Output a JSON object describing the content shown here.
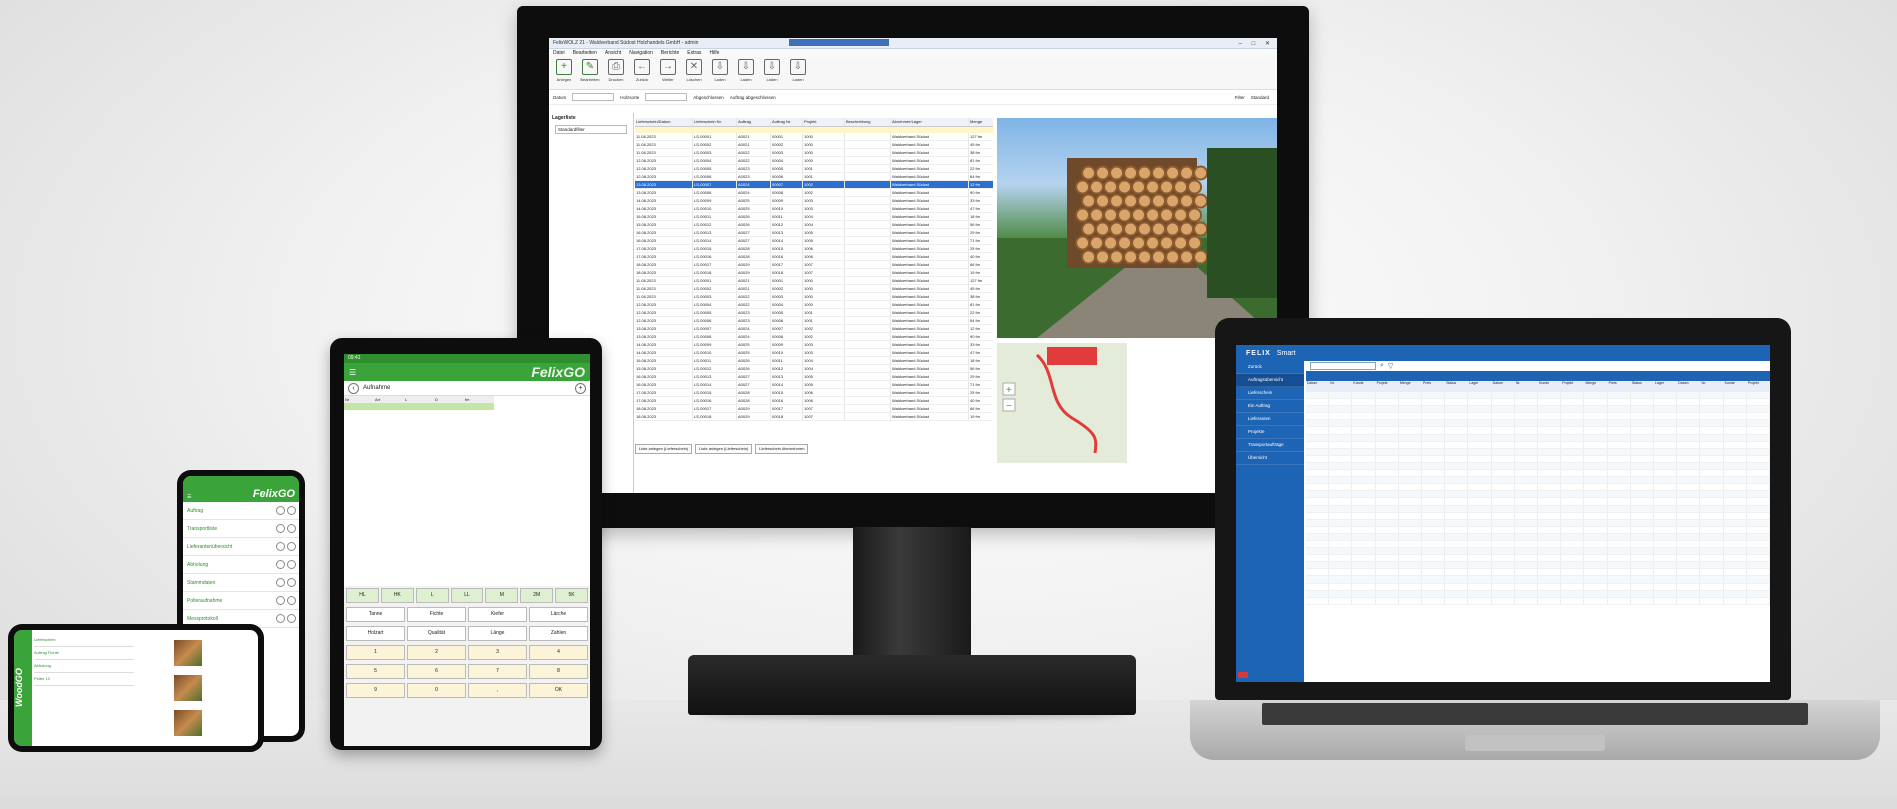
{
  "monitor": {
    "window_title": "FelixWOLZ 21 - Waldverband Südost Holzhandels GmbH - admin",
    "menu": [
      "Datei",
      "Bearbeiten",
      "Ansicht",
      "Navigation",
      "Berichte",
      "Extras",
      "Hilfe"
    ],
    "toolbar": [
      "Anlegen",
      "Bearbeiten",
      "Drucken",
      "Zurück",
      "Weiter",
      "Löschen",
      "Laden",
      "Laden",
      "Laden",
      "Laden"
    ],
    "filter": {
      "date_label": "Datum",
      "type_label": "Holzsorte",
      "check1": "Abgeschlossen",
      "check2": "Auftrag abgeschlossen",
      "range_label": "Filter",
      "range_value": "Standard"
    },
    "left_panel": {
      "title": "Lagerliste",
      "item": "Standardfilter"
    },
    "columns": [
      "Lieferschein/Datum",
      "Lieferschein Nr.",
      "Auftrag",
      "Auftrag Nr.",
      "Projekt",
      "Beschreibung",
      "Abnehmer/Lager",
      "Menge"
    ],
    "rows": [
      [
        "11.08.2023",
        "LS-00001",
        "A0021",
        "00001",
        "1000",
        "",
        "Waldverband Südost",
        "127 fm"
      ],
      [
        "11.08.2023",
        "LS-00002",
        "A0021",
        "00002",
        "1000",
        "",
        "Waldverband Südost",
        "45 fm"
      ],
      [
        "11.08.2023",
        "LS-00003",
        "A0022",
        "00003",
        "1000",
        "",
        "Waldverband Südost",
        "38 fm"
      ],
      [
        "12.08.2023",
        "LS-00004",
        "A0022",
        "00004",
        "1000",
        "",
        "Waldverband Südost",
        "81 fm"
      ],
      [
        "12.08.2023",
        "LS-00005",
        "A0023",
        "00005",
        "1001",
        "",
        "Waldverband Südost",
        "22 fm"
      ],
      [
        "12.08.2023",
        "LS-00006",
        "A0023",
        "00006",
        "1001",
        "",
        "Waldverband Südost",
        "64 fm"
      ],
      [
        "13.08.2023",
        "LS-00007",
        "A0024",
        "00007",
        "1002",
        "",
        "Waldverband Südost",
        "12 fm"
      ],
      [
        "13.08.2023",
        "LS-00008",
        "A0024",
        "00008",
        "1002",
        "",
        "Waldverband Südost",
        "90 fm"
      ],
      [
        "14.08.2023",
        "LS-00009",
        "A0025",
        "00009",
        "1003",
        "",
        "Waldverband Südost",
        "33 fm"
      ],
      [
        "14.08.2023",
        "LS-00010",
        "A0025",
        "00010",
        "1003",
        "",
        "Waldverband Südost",
        "47 fm"
      ],
      [
        "15.08.2023",
        "LS-00011",
        "A0026",
        "00011",
        "1004",
        "",
        "Waldverband Südost",
        "18 fm"
      ],
      [
        "15.08.2023",
        "LS-00012",
        "A0026",
        "00012",
        "1004",
        "",
        "Waldverband Südost",
        "56 fm"
      ],
      [
        "16.08.2023",
        "LS-00013",
        "A0027",
        "00013",
        "1005",
        "",
        "Waldverband Südost",
        "29 fm"
      ],
      [
        "16.08.2023",
        "LS-00014",
        "A0027",
        "00014",
        "1005",
        "",
        "Waldverband Südost",
        "71 fm"
      ],
      [
        "17.08.2023",
        "LS-00015",
        "A0028",
        "00015",
        "1006",
        "",
        "Waldverband Südost",
        "25 fm"
      ],
      [
        "17.08.2023",
        "LS-00016",
        "A0028",
        "00016",
        "1006",
        "",
        "Waldverband Südost",
        "40 fm"
      ],
      [
        "18.08.2023",
        "LS-00017",
        "A0029",
        "00017",
        "1007",
        "",
        "Waldverband Südost",
        "66 fm"
      ],
      [
        "18.08.2023",
        "LS-00018",
        "A0029",
        "00018",
        "1007",
        "",
        "Waldverband Südost",
        "19 fm"
      ]
    ],
    "footer_buttons": [
      "Liste anlegen (Lieferschein)",
      "Liste anlegen (Lieferschein)",
      "Lieferschein übernehmen"
    ]
  },
  "laptop": {
    "brand": "FELIX",
    "brand_sub": "Smart",
    "side": [
      "Zurück",
      "Auftragsübersicht",
      "Lieferschein",
      "Ein Auftrag",
      "Lieferanten",
      "Projekte",
      "Transportaufträge",
      "Übersicht"
    ],
    "columns": [
      "Datum",
      "Nr.",
      "Kunde",
      "Projekt",
      "Menge",
      "Preis",
      "Status",
      "Lager"
    ],
    "rows_count": 30
  },
  "tablet": {
    "status": "09:41",
    "brand": "FelixGO",
    "title": "Aufnahme",
    "table_head": [
      "Nr",
      "Art",
      "L",
      "D",
      "fm"
    ],
    "keys_row1": [
      "HL",
      "HK",
      "L",
      "LL",
      "M",
      "2M",
      "5K"
    ],
    "keys_row2": [
      "Tanne",
      "Fichte",
      "Kiefer",
      "Lärche"
    ],
    "keys_labels": [
      "Holzart",
      "Qualität",
      "Länge",
      "Zahlen"
    ],
    "numpad": [
      "1",
      "2",
      "3",
      "4",
      "5",
      "6",
      "7",
      "8",
      "9",
      "0",
      ",",
      "OK"
    ]
  },
  "phone1": {
    "brand": "FelixGO",
    "items": [
      "Auftrag",
      "Transportliste",
      "Lieferantenübersicht",
      "Abholung",
      "Stammdaten",
      "Polteraufnahme",
      "Messprotokoll"
    ]
  },
  "phone2": {
    "brand": "WoodGO",
    "list": [
      "Lieferschein",
      "Auftrag Fichte",
      "Abholung",
      "Polter 12"
    ]
  }
}
